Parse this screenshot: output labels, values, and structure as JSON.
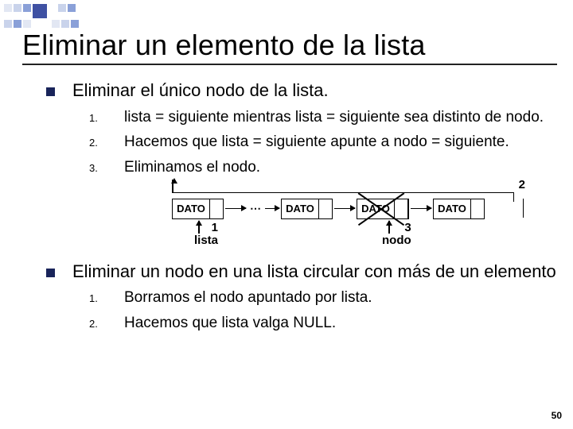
{
  "title": "Eliminar un elemento de la lista",
  "section_a": {
    "heading": "Eliminar el único nodo de la lista.",
    "steps": [
      "lista = siguiente mientras lista = siguiente sea distinto de nodo.",
      "Hacemos que lista = siguiente apunte a nodo = siguiente.",
      "Eliminamos el nodo."
    ]
  },
  "diagram": {
    "node_label": "DATO",
    "pointer1_label": "lista",
    "pointer1_num": "1",
    "pointer3_label": "nodo",
    "pointer3_num": "3",
    "top_num": "2"
  },
  "section_b": {
    "heading": "Eliminar un nodo en una lista circular con más de un elemento",
    "steps": [
      "Borramos el nodo apuntado por lista.",
      "Hacemos que lista valga NULL."
    ]
  },
  "page_number": "50"
}
